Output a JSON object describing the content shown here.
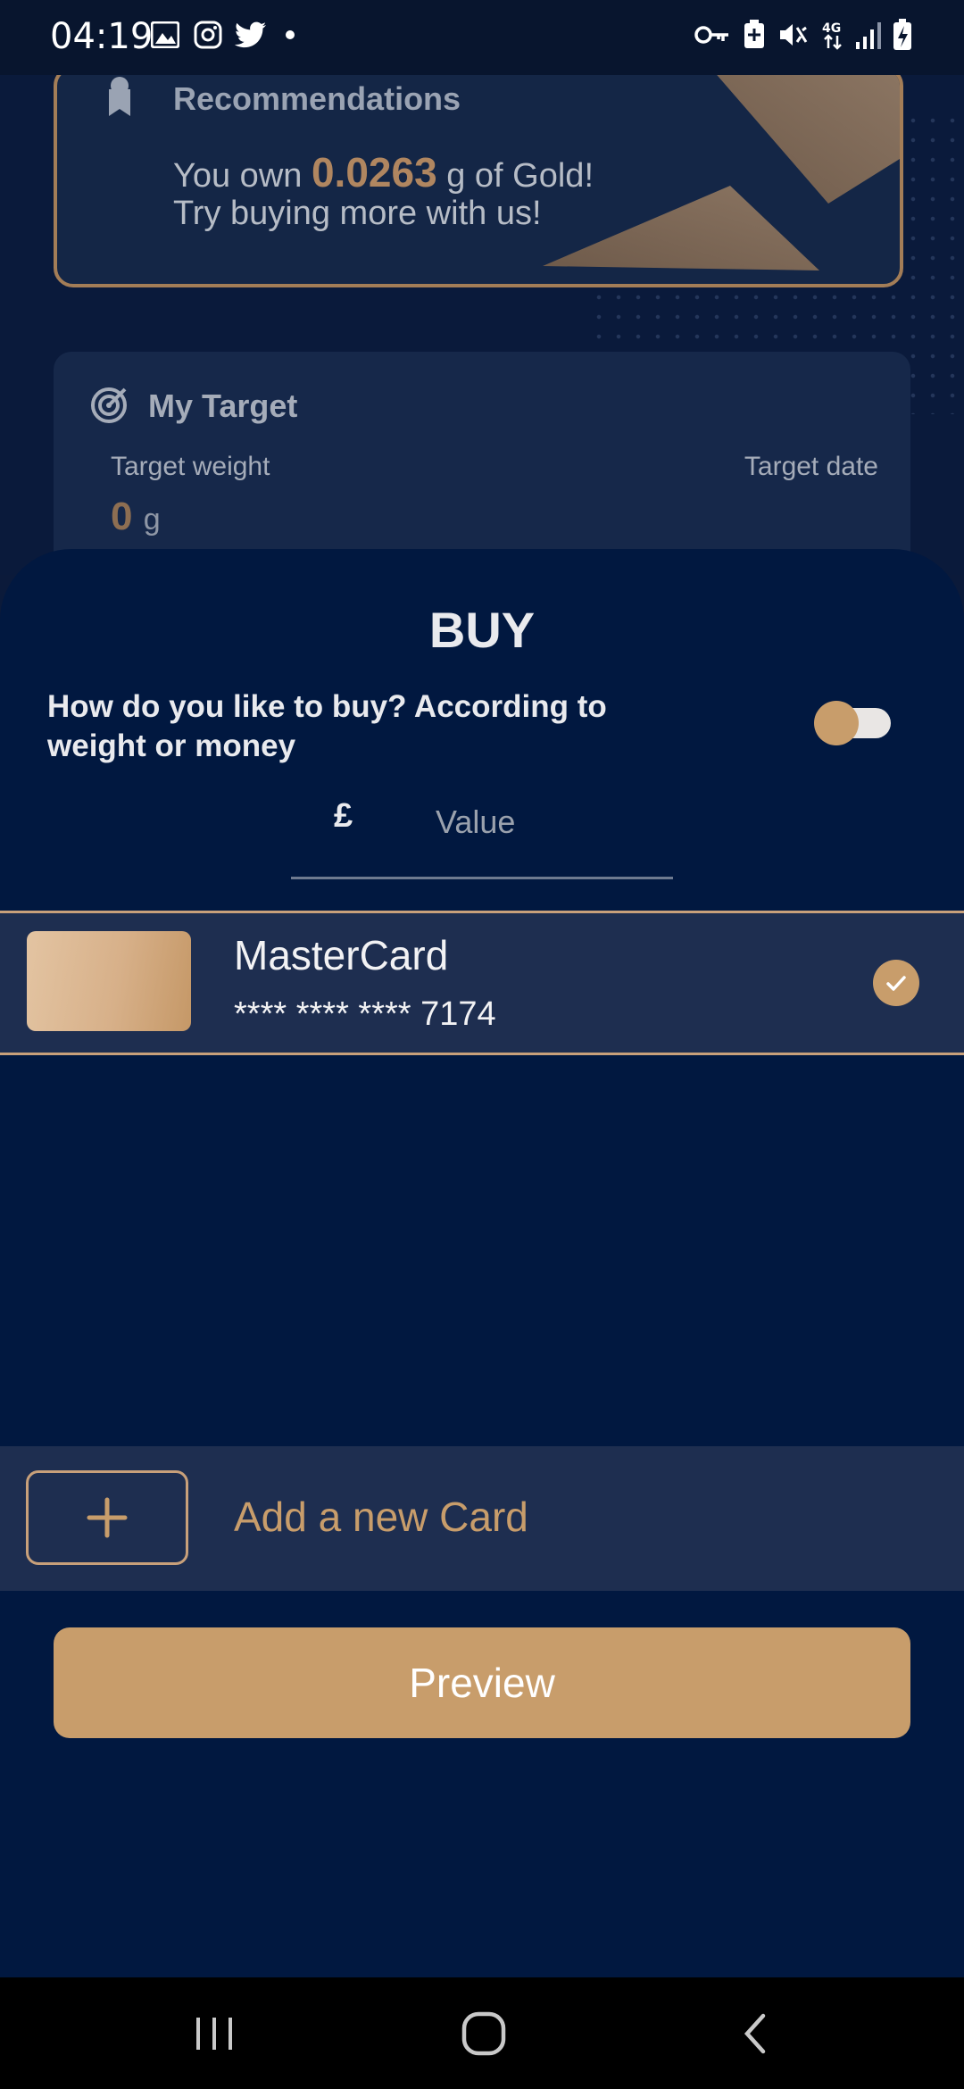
{
  "status_bar": {
    "time": "04:19",
    "left_icons": [
      "image-icon",
      "instagram-icon",
      "twitter-icon",
      "dot-icon"
    ],
    "right_icons": [
      "key-icon",
      "battery-saver-icon",
      "mute-icon",
      "network-4g-icon",
      "signal-icon",
      "battery-charging-icon"
    ]
  },
  "recommendations": {
    "title": "Recommendations",
    "line1_prefix": "You own",
    "amount": "0.0263",
    "line1_suffix": "g of Gold!",
    "line2": "Try buying more with us!"
  },
  "target": {
    "title": "My Target",
    "weight_label": "Target weight",
    "date_label": "Target date",
    "weight_value": "0",
    "weight_unit": "g"
  },
  "buy_sheet": {
    "title": "BUY",
    "question": "How do you like to buy? According to weight or money",
    "toggle_on": false,
    "currency_symbol": "£",
    "value_placeholder": "Value",
    "value": ""
  },
  "card": {
    "name": "MasterCard",
    "number": "**** **** **** 7174",
    "selected": true
  },
  "add_card": {
    "icon": "plus-icon",
    "label": "Add a new Card"
  },
  "preview_button": {
    "label": "Preview"
  },
  "nav_bar": {
    "items": [
      "recents-icon",
      "home-icon",
      "back-icon"
    ]
  },
  "colors": {
    "accent": "#c89d6b",
    "sheet_bg": "#011840",
    "card_row_bg": "#1e2e50"
  }
}
